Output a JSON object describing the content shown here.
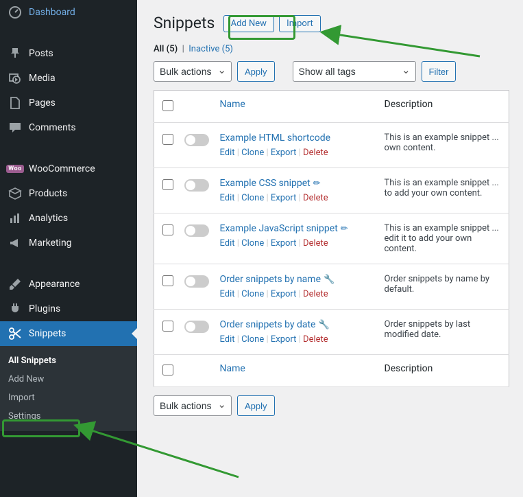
{
  "sidebar": {
    "items": [
      {
        "label": "Dashboard"
      },
      {
        "label": "Posts"
      },
      {
        "label": "Media"
      },
      {
        "label": "Pages"
      },
      {
        "label": "Comments"
      },
      {
        "label": "WooCommerce"
      },
      {
        "label": "Products"
      },
      {
        "label": "Analytics"
      },
      {
        "label": "Marketing"
      },
      {
        "label": "Appearance"
      },
      {
        "label": "Plugins"
      },
      {
        "label": "Snippets"
      }
    ],
    "submenu": {
      "all": "All Snippets",
      "add": "Add New",
      "import": "Import",
      "settings": "Settings"
    }
  },
  "header": {
    "title": "Snippets",
    "add_new": "Add New",
    "import": "Import"
  },
  "subsub": {
    "all": "All",
    "all_count": "(5)",
    "inactive": "Inactive",
    "inactive_count": "(5)"
  },
  "bulk": {
    "label": "Bulk actions",
    "apply": "Apply",
    "tags": "Show all tags",
    "filter": "Filter"
  },
  "columns": {
    "name": "Name",
    "desc": "Description"
  },
  "actions": {
    "edit": "Edit",
    "clone": "Clone",
    "export": "Export",
    "delete": "Delete"
  },
  "rows": [
    {
      "title": "Example HTML shortcode",
      "desc": "This is an example snippet ... own content.",
      "tool": ""
    },
    {
      "title": "Example CSS snippet",
      "desc": "This is an example snippet ... to add your own content.",
      "tool": "✏"
    },
    {
      "title": "Example JavaScript snippet",
      "desc": "This is an example snippet ... edit it to add your own content.",
      "tool": "✏"
    },
    {
      "title": "Order snippets by name",
      "desc": "Order snippets by name by default.",
      "tool": "🔧"
    },
    {
      "title": "Order snippets by date",
      "desc": "Order snippets by last modified date.",
      "tool": "🔧"
    }
  ]
}
